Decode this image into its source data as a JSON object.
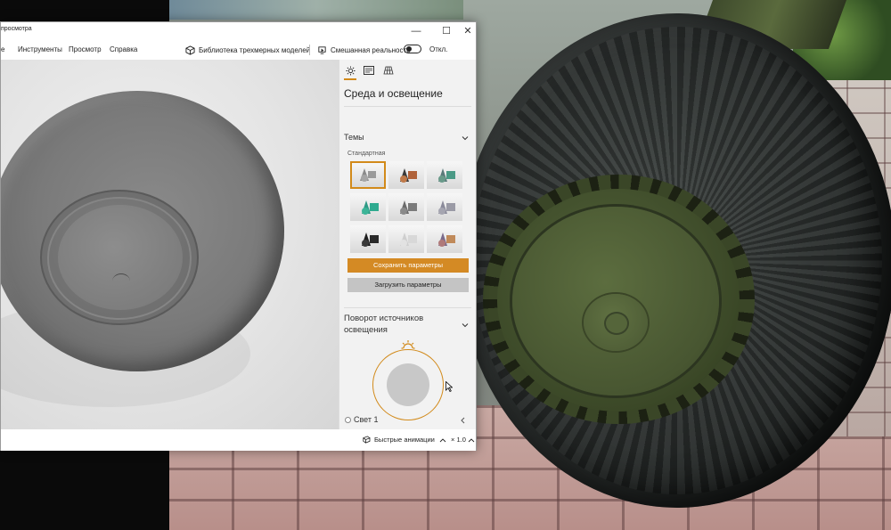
{
  "window": {
    "title": "просмотра",
    "controls": {
      "minimize": "—",
      "maximize": "☐",
      "close": "✕"
    }
  },
  "menu": {
    "items": [
      "е",
      "Инструменты",
      "Просмотр",
      "Справка"
    ],
    "library_label": "Библиотека трехмерных моделей",
    "mixed_reality_label": "Смешанная реальность",
    "toggle_state": "Откл."
  },
  "panel": {
    "tabs": [
      "sun-icon",
      "stats-icon",
      "grid-icon"
    ],
    "title": "Среда и освещение",
    "themes_heading": "Темы",
    "standard_label": "Стандартная",
    "save_button": "Сохранить параметры",
    "load_button": "Загрузить параметры",
    "rotation_heading": "Поворот источников освещения",
    "light_item": "Свет 1",
    "accent_color": "#D28A1A"
  },
  "statusbar": {
    "animations_label": "Быстрые анимации",
    "speed_label": "× 1.0"
  }
}
